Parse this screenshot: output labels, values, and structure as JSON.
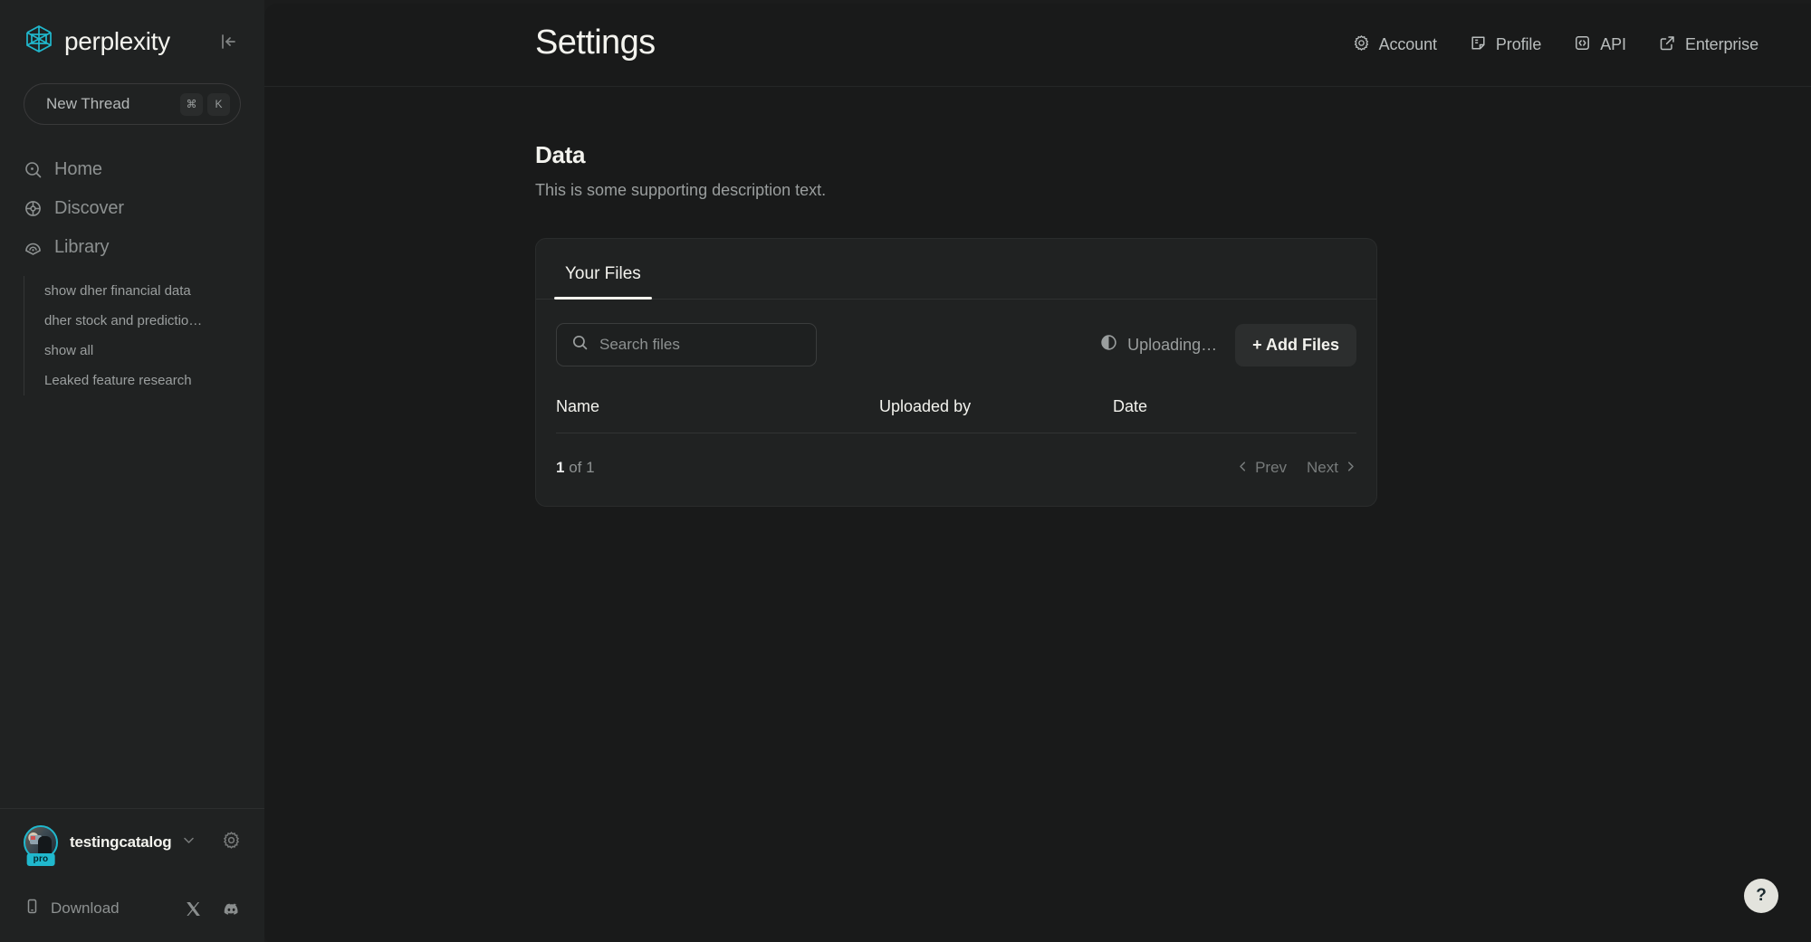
{
  "brand": {
    "name": "perplexity",
    "logo_icon": "perplexity-logo-icon",
    "collapse_icon": "collapse-sidebar-icon"
  },
  "sidebar": {
    "new_thread": {
      "label": "New Thread",
      "keys": [
        "⌘",
        "K"
      ]
    },
    "nav": [
      {
        "label": "Home",
        "icon": "home-search-icon"
      },
      {
        "label": "Discover",
        "icon": "discover-globe-icon"
      },
      {
        "label": "Library",
        "icon": "library-icon"
      }
    ],
    "threads": [
      "show dher financial data",
      "dher stock and predictio…",
      "show all",
      "Leaked feature research"
    ],
    "user": {
      "name": "testingcatalog",
      "badge": "pro",
      "chevron_icon": "chevron-down-icon",
      "settings_icon": "gear-icon",
      "avatar_icon": "avatar"
    },
    "footer": {
      "download_label": "Download",
      "download_icon": "mobile-phone-icon",
      "x_icon": "x-twitter-icon",
      "discord_icon": "discord-icon"
    }
  },
  "header": {
    "title": "Settings",
    "nav": [
      {
        "label": "Account",
        "icon": "gear-icon"
      },
      {
        "label": "Profile",
        "icon": "note-icon"
      },
      {
        "label": "API",
        "icon": "code-brackets-icon"
      },
      {
        "label": "Enterprise",
        "icon": "external-link-icon"
      }
    ]
  },
  "main": {
    "section_title": "Data",
    "section_description": "This is some supporting description text.",
    "tabs": [
      {
        "label": "Your Files",
        "active": true
      }
    ],
    "search": {
      "placeholder": "Search files",
      "value": "",
      "icon": "search-icon"
    },
    "uploading": {
      "label": "Uploading…",
      "icon": "uploading-spinner-icon"
    },
    "add_files_label": "+ Add Files",
    "table": {
      "columns": [
        "Name",
        "Uploaded by",
        "Date"
      ],
      "rows": []
    },
    "pagination": {
      "current": "1",
      "of_text": " of 1",
      "prev_label": "Prev",
      "next_label": "Next",
      "prev_icon": "chevron-left-icon",
      "next_icon": "chevron-right-icon"
    }
  },
  "help": {
    "label": "?"
  },
  "colors": {
    "accent": "#20b8cd",
    "bg": "#191a1a",
    "sidebar_bg": "#202222",
    "card_bg": "#202222",
    "text": "#f3f3ee",
    "muted": "#8d9191"
  }
}
